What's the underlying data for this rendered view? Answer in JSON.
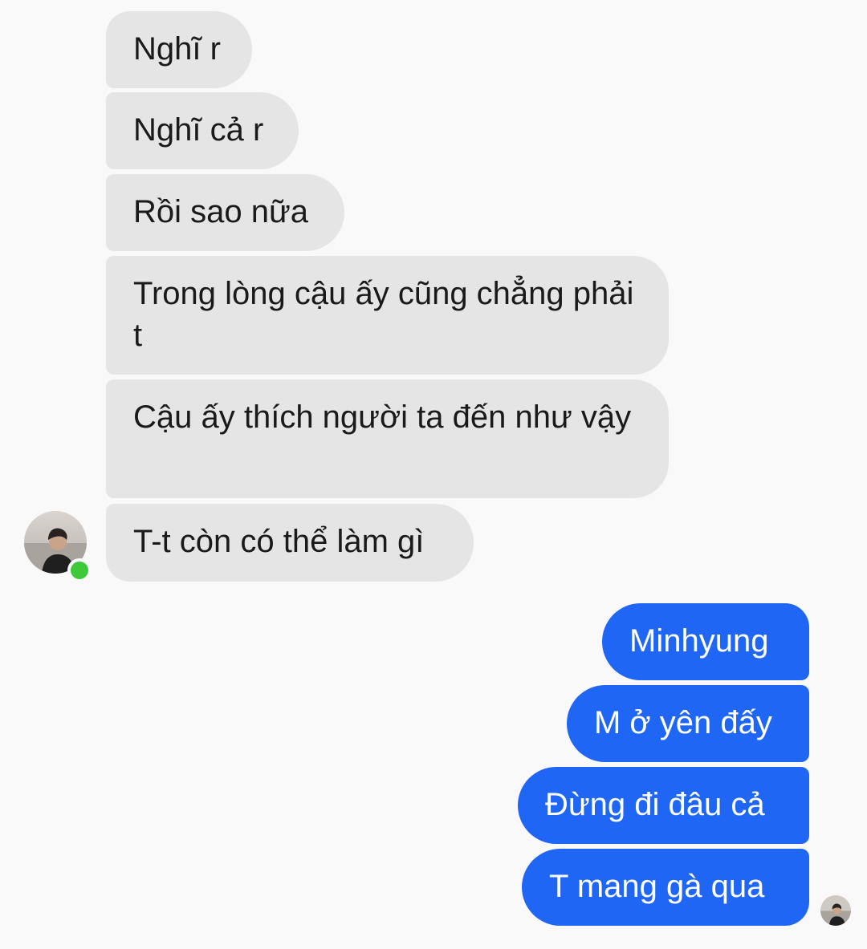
{
  "thread": {
    "received": [
      {
        "text": "Nghĩ r"
      },
      {
        "text": "Nghĩ cả r"
      },
      {
        "text": "Rồi sao nữa"
      },
      {
        "text": "Trong lòng cậu ấy cũng chẳng phải t"
      },
      {
        "text": "Cậu ấy thích người ta đến như vậy"
      },
      {
        "text": "T-t còn có thể làm gì"
      }
    ],
    "sent": [
      {
        "text": "Minhyung"
      },
      {
        "text": "M ở yên đấy"
      },
      {
        "text": "Đừng đi đâu cả"
      },
      {
        "text": "T mang gà qua"
      }
    ]
  },
  "contact": {
    "avatar_icon": "person-photo-icon",
    "online": true
  },
  "colors": {
    "background": "#f9f9f9",
    "received_bubble": "#e5e5e5",
    "sent_bubble": "#1f66f5",
    "online_dot": "#3ec93a"
  }
}
